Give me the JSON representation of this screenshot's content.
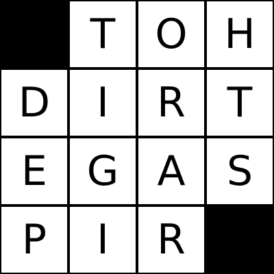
{
  "puzzle": {
    "colors": {
      "fill": "#ffffff",
      "block": "#000000",
      "grid_line": "#000000",
      "letter": "#000000"
    },
    "rows": [
      [
        {
          "block": true,
          "letter": ""
        },
        {
          "block": false,
          "letter": "T"
        },
        {
          "block": false,
          "letter": "O"
        },
        {
          "block": false,
          "letter": "H"
        }
      ],
      [
        {
          "block": false,
          "letter": "D"
        },
        {
          "block": false,
          "letter": "I"
        },
        {
          "block": false,
          "letter": "R"
        },
        {
          "block": false,
          "letter": "T"
        }
      ],
      [
        {
          "block": false,
          "letter": "E"
        },
        {
          "block": false,
          "letter": "G"
        },
        {
          "block": false,
          "letter": "A"
        },
        {
          "block": false,
          "letter": "S"
        }
      ],
      [
        {
          "block": false,
          "letter": "P"
        },
        {
          "block": false,
          "letter": "I"
        },
        {
          "block": false,
          "letter": "R"
        },
        {
          "block": true,
          "letter": ""
        }
      ]
    ]
  }
}
